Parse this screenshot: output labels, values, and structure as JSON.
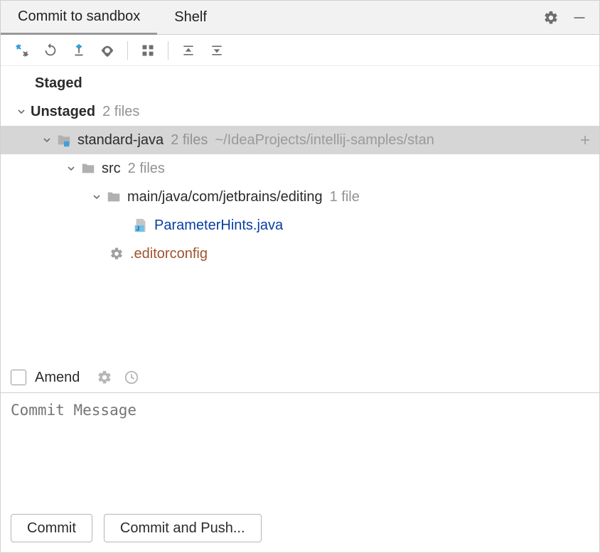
{
  "tabs": {
    "commit": "Commit to sandbox",
    "shelf": "Shelf"
  },
  "tree": {
    "staged": {
      "label": "Staged"
    },
    "unstaged": {
      "label": "Unstaged",
      "meta": "2 files",
      "project": {
        "name": "standard-java",
        "meta": "2 files",
        "path": "~/IdeaProjects/intellij-samples/stan",
        "src": {
          "name": "src",
          "meta": "2 files",
          "pkg": {
            "name": "main/java/com/jetbrains/editing",
            "meta": "1 file",
            "file": "ParameterHints.java"
          },
          "config": ".editorconfig"
        }
      }
    }
  },
  "amend": {
    "label": "Amend"
  },
  "commitMessage": {
    "placeholder": "Commit Message"
  },
  "buttons": {
    "commit": "Commit",
    "commitPush": "Commit and Push..."
  }
}
